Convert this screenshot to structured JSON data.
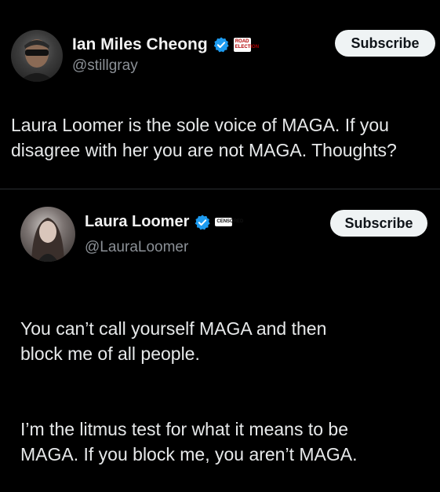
{
  "tweet1": {
    "author_name": "Ian Miles Cheong",
    "handle": "@stillgray",
    "badge_text": "ROAD ELECTION",
    "subscribe_label": "Subscribe",
    "text": "Laura Loomer is the sole voice of MAGA. If you\ndisagree with her you are not MAGA. Thoughts?"
  },
  "tweet2": {
    "author_name": "Laura Loomer",
    "handle": "@LauraLoomer",
    "badge_text": "CENSORED",
    "subscribe_label": "Subscribe",
    "paragraph1": "You can’t call yourself MAGA and then\nblock me of all people.",
    "paragraph2": "I’m the litmus test for what it means to be\nMAGA. If you block me, you aren’t MAGA."
  },
  "colors": {
    "background": "#000000",
    "verified": "#1d9bf0",
    "text": "#e7e9ea",
    "muted": "#8b9096"
  },
  "icons": [
    "verified-badge-icon",
    "avatar-image"
  ]
}
